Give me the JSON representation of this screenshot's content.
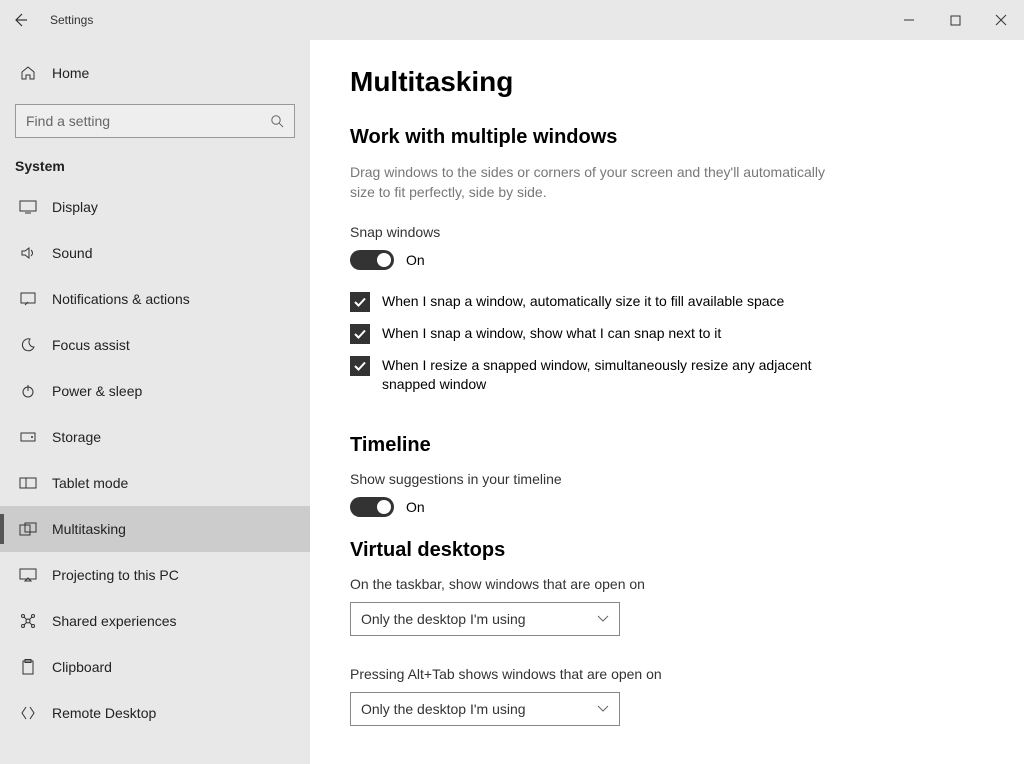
{
  "appTitle": "Settings",
  "home": "Home",
  "search": {
    "placeholder": "Find a setting"
  },
  "category": "System",
  "nav": [
    {
      "key": "display",
      "label": "Display"
    },
    {
      "key": "sound",
      "label": "Sound"
    },
    {
      "key": "notifications",
      "label": "Notifications & actions"
    },
    {
      "key": "focus",
      "label": "Focus assist"
    },
    {
      "key": "power",
      "label": "Power & sleep"
    },
    {
      "key": "storage",
      "label": "Storage"
    },
    {
      "key": "tablet",
      "label": "Tablet mode"
    },
    {
      "key": "multitask",
      "label": "Multitasking"
    },
    {
      "key": "project",
      "label": "Projecting to this PC"
    },
    {
      "key": "shared",
      "label": "Shared experiences"
    },
    {
      "key": "clipboard",
      "label": "Clipboard"
    },
    {
      "key": "remote",
      "label": "Remote Desktop"
    }
  ],
  "page": {
    "title": "Multitasking",
    "windows": {
      "heading": "Work with multiple windows",
      "desc": "Drag windows to the sides or corners of your screen and they'll automatically size to fit perfectly, side by side.",
      "snapLabel": "Snap windows",
      "snapState": "On",
      "checks": {
        "a": "When I snap a window, automatically size it to fill available space",
        "b": "When I snap a window, show what I can snap next to it",
        "c": "When I resize a snapped window, simultaneously resize any adjacent snapped window"
      }
    },
    "timeline": {
      "heading": "Timeline",
      "suggLabel": "Show suggestions in your timeline",
      "state": "On"
    },
    "vd": {
      "heading": "Virtual desktops",
      "taskbarLabel": "On the taskbar, show windows that are open on",
      "taskbarValue": "Only the desktop I'm using",
      "alttabLabel": "Pressing Alt+Tab shows windows that are open on",
      "alttabValue": "Only the desktop I'm using"
    }
  }
}
